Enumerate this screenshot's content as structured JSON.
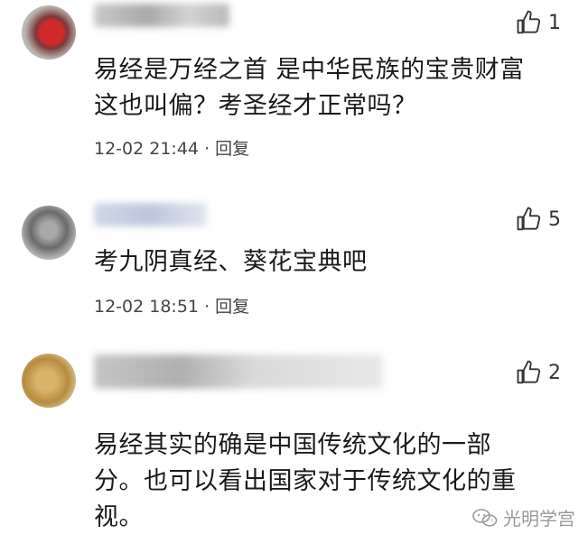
{
  "comments": [
    {
      "likes": "1",
      "text_lines": [
        "易经是万经之首 是中华民族的宝贵财富",
        "这也叫偏？考圣经才正常吗？"
      ],
      "time": "12-02 21:44",
      "separator": "·",
      "reply_label": "回复"
    },
    {
      "likes": "5",
      "text_lines": [
        "考九阴真经、葵花宝典吧"
      ],
      "time": "12-02 18:51",
      "separator": "·",
      "reply_label": "回复"
    },
    {
      "likes": "2",
      "text_lines": [
        "易经其实的确是中国传统文化的一部",
        "分。也可以看出国家对于传统文化的重",
        "视。"
      ]
    }
  ],
  "watermark": {
    "text": "光明学宫",
    "icon": "wechat-icon"
  },
  "icons": {
    "like": "thumbs-up-icon"
  }
}
